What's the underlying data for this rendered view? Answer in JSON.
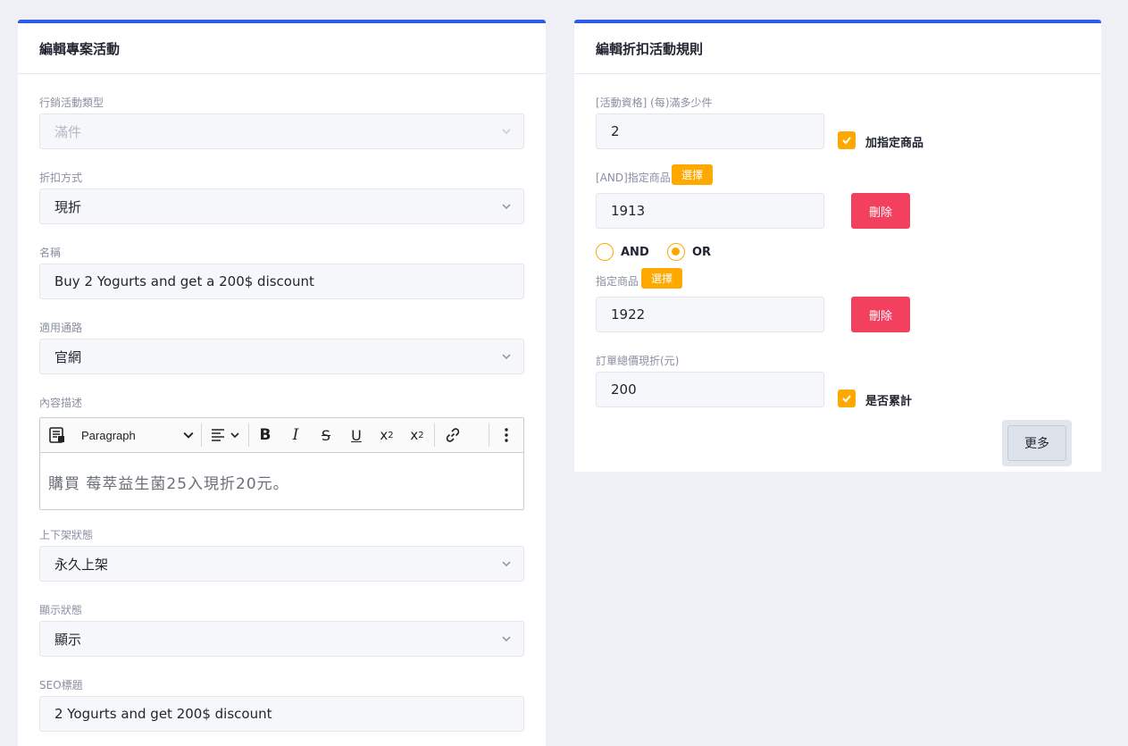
{
  "left_card": {
    "title": "編輯專案活動",
    "campaign_type": {
      "label": "行銷活動類型",
      "value": "滿件"
    },
    "discount_method": {
      "label": "折扣方式",
      "value": "現折"
    },
    "name": {
      "label": "名稱",
      "value": "Buy 2 Yogurts and get a 200$ discount"
    },
    "channel": {
      "label": "適用通路",
      "value": "官網"
    },
    "description": {
      "label": "內容描述",
      "paragraph_style": "Paragraph",
      "content": "購買 莓萃益生菌25入現折20元。"
    },
    "shelf_status": {
      "label": "上下架狀態",
      "value": "永久上架"
    },
    "display_status": {
      "label": "顯示狀態",
      "value": "顯示"
    },
    "seo_title": {
      "label": "SEO標題",
      "value": "2 Yogurts and get 200$ discount"
    }
  },
  "right_card": {
    "title": "編輯折扣活動規則",
    "min_qty": {
      "label": "[活動資格] (每)滿多少件",
      "value": "2"
    },
    "add_product_checkbox": {
      "label": "加指定商品",
      "checked": true
    },
    "and_product": {
      "label": "[AND]指定商品",
      "choose_label": "選擇",
      "value": "1913",
      "delete_label": "刪除"
    },
    "logic": {
      "and_label": "AND",
      "or_label": "OR",
      "selected": "OR"
    },
    "product": {
      "label": "指定商品",
      "choose_label": "選擇",
      "value": "1922",
      "delete_label": "刪除"
    },
    "order_discount": {
      "label": "訂單總價現折(元)",
      "value": "200"
    },
    "cumulative_checkbox": {
      "label": "是否累計",
      "checked": true
    },
    "more_label": "更多"
  },
  "colors": {
    "accent_blue": "#2f5ce9",
    "orange": "#ffa800",
    "delete_red": "#f3405f"
  }
}
